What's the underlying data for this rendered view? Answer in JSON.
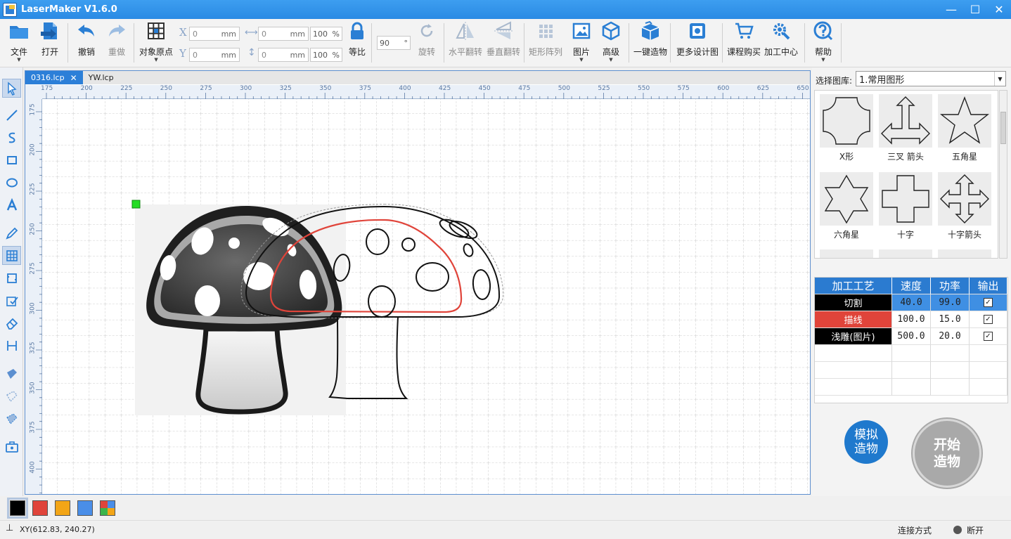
{
  "window": {
    "title": "LaserMaker V1.6.0",
    "minimize": "—",
    "maximize": "☐",
    "close": "✕"
  },
  "toolbar": {
    "file": "文件",
    "open": "打开",
    "undo": "撤销",
    "redo": "重做",
    "origin": "对象原点",
    "x_label": "X",
    "y_label": "Y",
    "x_value": "0",
    "y_value": "0",
    "unit": "mm",
    "width_value": "0",
    "height_value": "0",
    "scale_w": "100",
    "scale_h": "100",
    "percent": "%",
    "lock_ratio": "等比",
    "angle_value": "90",
    "degree": "°",
    "rotate": "旋转",
    "flip_h": "水平翻转",
    "flip_v": "垂直翻转",
    "array": "矩形阵列",
    "image": "图片",
    "advanced": "高级",
    "one_click": "一键造物",
    "more_designs": "更多设计图",
    "courses": "课程购买",
    "processing_center": "加工中心",
    "help": "帮助"
  },
  "tabs": [
    {
      "label": "0316.lcp",
      "close": "✕"
    },
    {
      "label": "YW.lcp"
    }
  ],
  "ruler": {
    "x_ticks": [
      "175",
      "200",
      "225",
      "250",
      "275",
      "300",
      "325",
      "350",
      "375",
      "400",
      "425",
      "450",
      "475",
      "500",
      "525",
      "550",
      "575",
      "600",
      "625",
      "650"
    ],
    "y_ticks": [
      "175",
      "200",
      "225",
      "250",
      "275",
      "300",
      "325",
      "350",
      "375",
      "400"
    ]
  },
  "library": {
    "label": "选择图库:",
    "selected": "1.常用图形",
    "shapes": [
      {
        "name": "X形",
        "icon": "x-shape-icon"
      },
      {
        "name": "三叉 箭头",
        "icon": "three-way-arrow-icon"
      },
      {
        "name": "五角星",
        "icon": "five-point-star-icon"
      },
      {
        "name": "六角星",
        "icon": "six-point-star-icon"
      },
      {
        "name": "十字",
        "icon": "cross-icon"
      },
      {
        "name": "十字箭头",
        "icon": "cross-arrow-icon"
      }
    ]
  },
  "process_table": {
    "headers": [
      "加工工艺",
      "速度",
      "功率",
      "输出"
    ],
    "rows": [
      {
        "process": "切割",
        "speed": "40.0",
        "power": "99.0",
        "output": "✓",
        "color": "#000000"
      },
      {
        "process": "描线",
        "speed": "100.0",
        "power": "15.0",
        "output": "✓",
        "color": "#e0443a"
      },
      {
        "process": "浅雕(图片)",
        "speed": "500.0",
        "power": "20.0",
        "output": "✓",
        "color": "#000000"
      }
    ]
  },
  "buttons": {
    "simulate": "模拟\n造物",
    "start": "开始\n造物"
  },
  "colors": [
    "#000000",
    "#e0443a",
    "#f3a516",
    "#4a8ee8",
    "multi"
  ],
  "status": {
    "xy": "XY(612.83, 240.27)",
    "connection_label": "连接方式",
    "connection_state": "断开"
  }
}
